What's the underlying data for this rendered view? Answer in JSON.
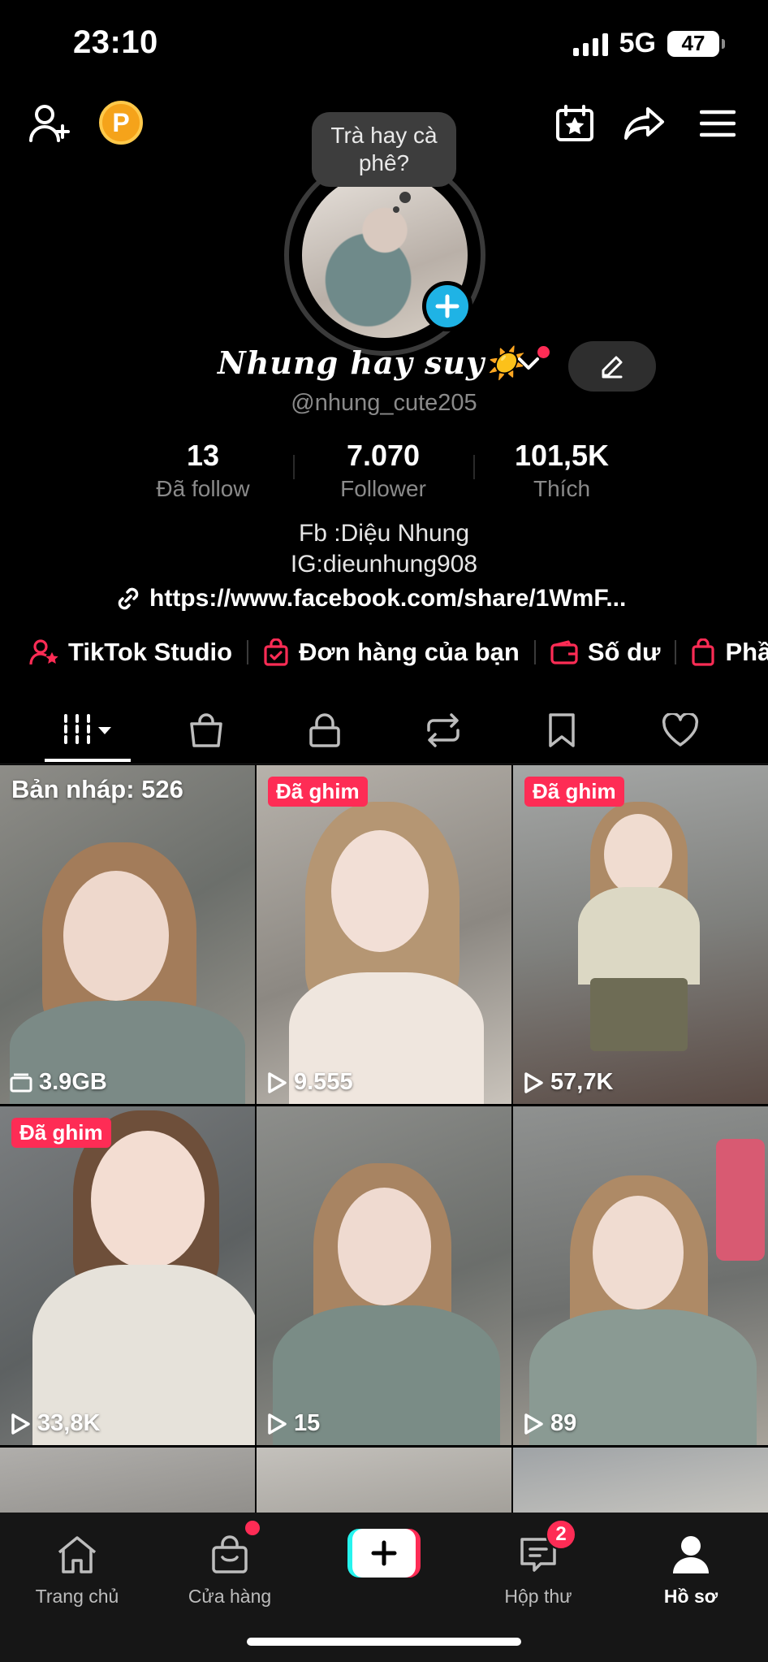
{
  "status_bar": {
    "time": "23:10",
    "network": "5G",
    "battery": "47"
  },
  "profile": {
    "bubble_note": "Trà hay cà phê?",
    "display_name": "Nhung hay suy☀️",
    "username": "@nhung_cute205",
    "stats": [
      {
        "value": "13",
        "label": "Đã follow"
      },
      {
        "value": "7.070",
        "label": "Follower"
      },
      {
        "value": "101,5K",
        "label": "Thích"
      }
    ],
    "bio_lines": [
      "Fb :Diệu Nhung",
      "IG:dieunhung908"
    ],
    "link": "https://www.facebook.com/share/1WmF..."
  },
  "quick_links": [
    {
      "label": "TikTok Studio",
      "icon": "person-star-icon"
    },
    {
      "label": "Đơn hàng của bạn",
      "icon": "order-bag-icon"
    },
    {
      "label": "Số dư",
      "icon": "wallet-icon"
    },
    {
      "label": "Phần",
      "icon": "shopping-bag-icon"
    }
  ],
  "tabs": [
    "videos-grid-icon",
    "shop-bag-icon",
    "private-lock-icon",
    "repost-icon",
    "saved-bookmark-icon",
    "liked-heart-icon"
  ],
  "videos": [
    {
      "draft_label": "Bản nháp: 526",
      "pin": "",
      "views": "3.9GB",
      "views_icon": "storage-icon"
    },
    {
      "draft_label": "",
      "pin": "Đã ghim",
      "views": "9.555",
      "views_icon": "play-icon"
    },
    {
      "draft_label": "",
      "pin": "Đã ghim",
      "views": "57,7K",
      "views_icon": "play-icon"
    },
    {
      "draft_label": "",
      "pin": "Đã ghim",
      "views": "33,8K",
      "views_icon": "play-icon"
    },
    {
      "draft_label": "",
      "pin": "",
      "views": "15",
      "views_icon": "play-icon"
    },
    {
      "draft_label": "",
      "pin": "",
      "views": "89",
      "views_icon": "play-icon"
    }
  ],
  "bottom_nav": {
    "home": "Trang chủ",
    "shop": "Cửa hàng",
    "inbox": "Hộp thư",
    "inbox_badge": "2",
    "profile": "Hồ sơ"
  },
  "colors": {
    "accent": "#fe2c55",
    "cyan": "#25f4ee",
    "avatar_add": "#1fb3e5",
    "coin": "#f5a31a"
  }
}
